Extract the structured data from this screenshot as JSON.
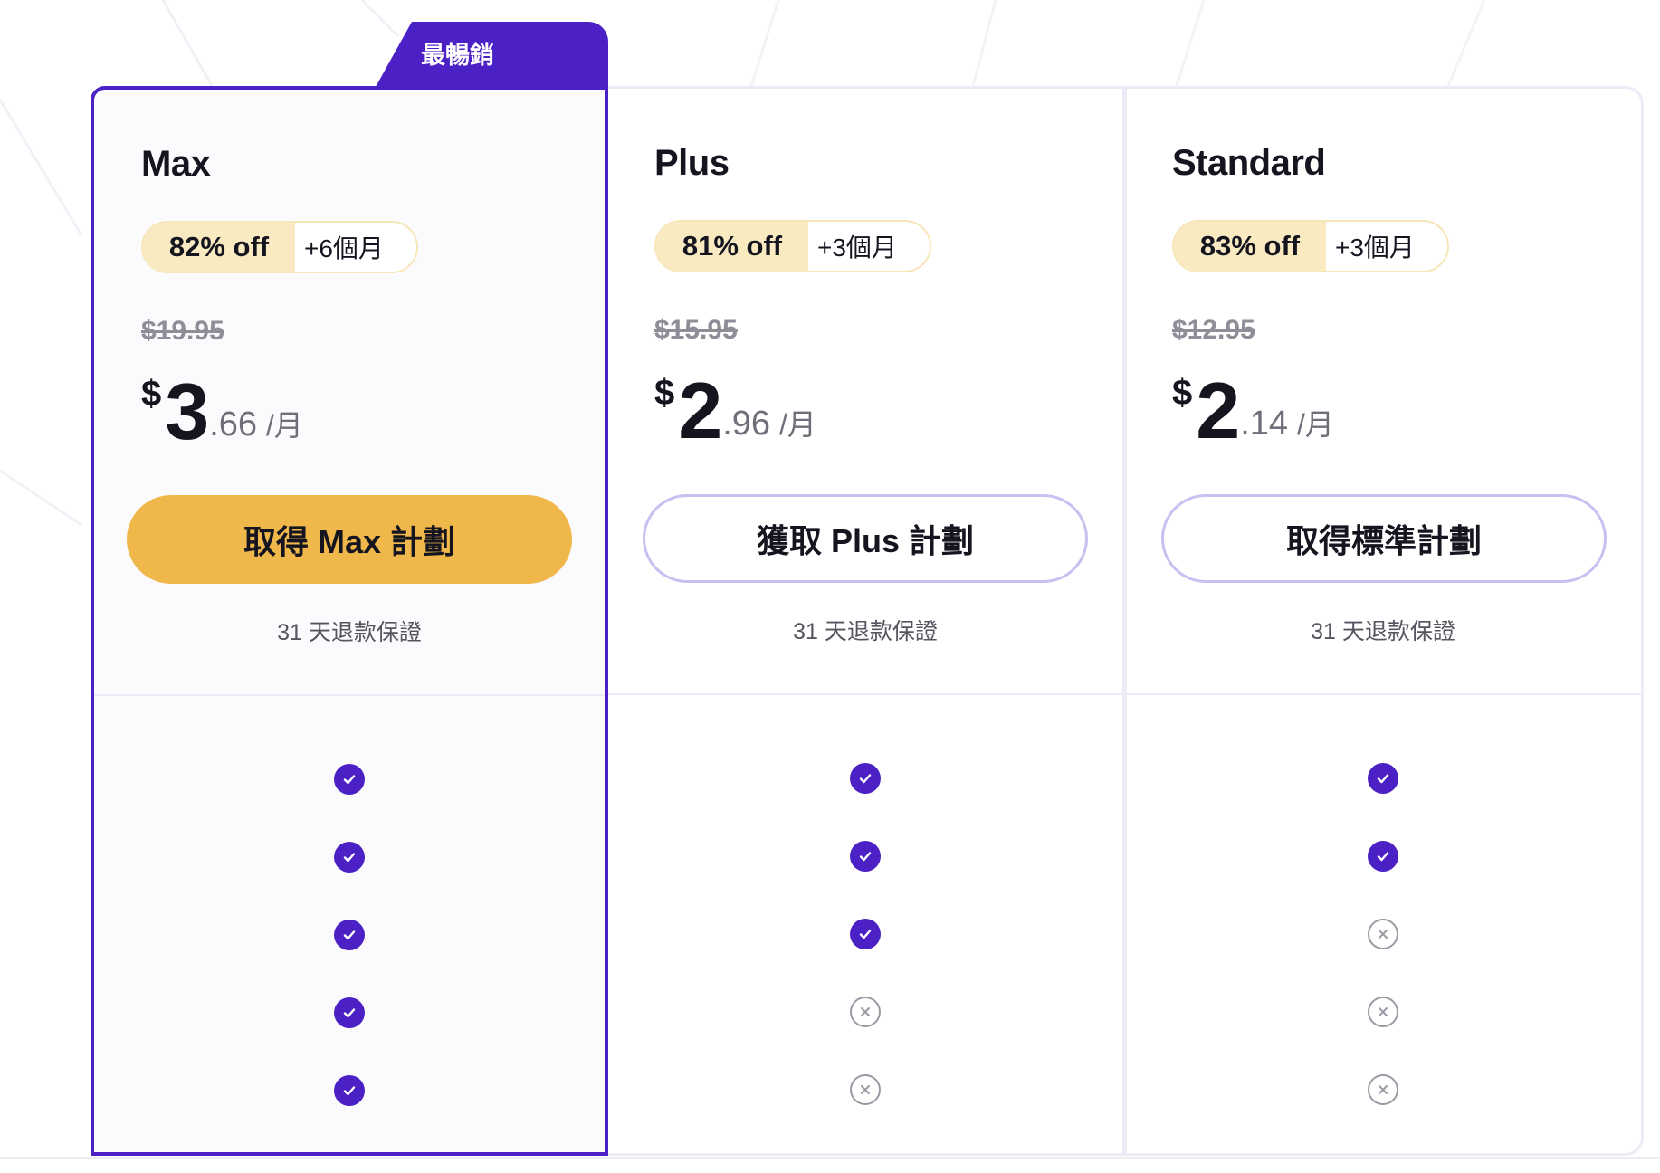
{
  "best_seller_label": "最暢銷",
  "colors": {
    "accent": "#4b21c5",
    "cta_primary": "#f0b84a",
    "badge_bg": "#faeac1",
    "text": "#151520"
  },
  "plans": [
    {
      "name": "Max",
      "discount": "82% off",
      "bonus": "+6個月",
      "old_price": "$19.95",
      "price_currency": "$",
      "price_int": "3",
      "price_dec": ".66",
      "price_unit": "/月",
      "cta_label": "取得 Max 計劃",
      "guarantee": "31 天退款保證",
      "features": [
        "check",
        "check",
        "check",
        "check",
        "check"
      ]
    },
    {
      "name": "Plus",
      "discount": "81% off",
      "bonus": "+3個月",
      "old_price": "$15.95",
      "price_currency": "$",
      "price_int": "2",
      "price_dec": ".96",
      "price_unit": "/月",
      "cta_label": "獲取 Plus 計劃",
      "guarantee": "31 天退款保證",
      "features": [
        "check",
        "check",
        "check",
        "cross",
        "cross"
      ]
    },
    {
      "name": "Standard",
      "discount": "83% off",
      "bonus": "+3個月",
      "old_price": "$12.95",
      "price_currency": "$",
      "price_int": "2",
      "price_dec": ".14",
      "price_unit": "/月",
      "cta_label": "取得標準計劃",
      "guarantee": "31 天退款保證",
      "features": [
        "check",
        "check",
        "cross",
        "cross",
        "cross"
      ]
    }
  ]
}
